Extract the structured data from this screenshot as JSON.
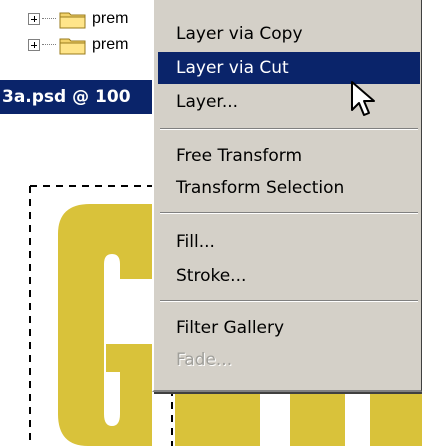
{
  "browser": {
    "tree_items": [
      {
        "label": "prem"
      },
      {
        "label": "prem"
      }
    ]
  },
  "document": {
    "title": "3a.psd @ 100"
  },
  "context_menu": {
    "groups": [
      [
        {
          "label": "Layer via Copy",
          "state": "normal"
        },
        {
          "label": "Layer via Cut",
          "state": "highlighted"
        },
        {
          "label": "Layer...",
          "state": "normal"
        }
      ],
      [
        {
          "label": "Free Transform",
          "state": "normal"
        },
        {
          "label": "Transform Selection",
          "state": "normal"
        }
      ],
      [
        {
          "label": "Fill...",
          "state": "normal"
        },
        {
          "label": "Stroke...",
          "state": "normal"
        }
      ],
      [
        {
          "label": "Filter Gallery",
          "state": "normal"
        },
        {
          "label": "Fade...",
          "state": "disabled"
        }
      ]
    ]
  },
  "colors": {
    "highlight": "#0a246a",
    "menu_bg": "#d4d0c8",
    "artwork_yellow": "#d9c23a"
  },
  "icons": {
    "folder": "folder-icon",
    "expander": "tree-expand-icon",
    "cursor": "arrow-cursor-icon"
  }
}
